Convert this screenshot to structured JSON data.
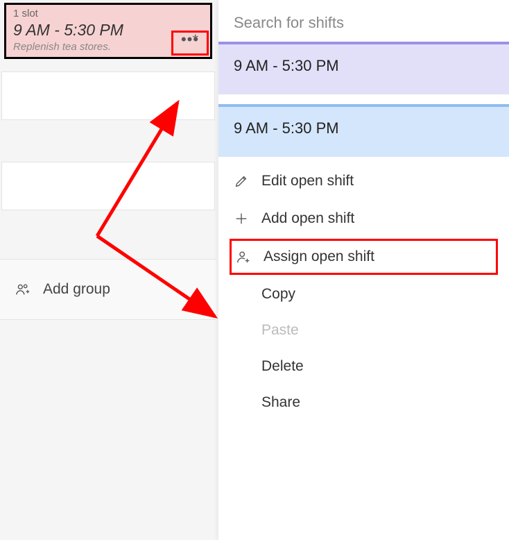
{
  "shiftCard": {
    "slotLabel": "1 slot",
    "time": "9 AM - 5:30 PM",
    "note": "Replenish tea stores.",
    "asterisk": "*"
  },
  "addGroup": {
    "label": "Add group"
  },
  "search": {
    "placeholder": "Search for shifts"
  },
  "shiftOptions": [
    {
      "label": "9 AM - 5:30 PM"
    },
    {
      "label": "9 AM - 5:30 PM"
    }
  ],
  "menu": {
    "editOpenShift": "Edit open shift",
    "addOpenShift": "Add open shift",
    "assignOpenShift": "Assign open shift",
    "copy": "Copy",
    "paste": "Paste",
    "delete": "Delete",
    "share": "Share"
  }
}
